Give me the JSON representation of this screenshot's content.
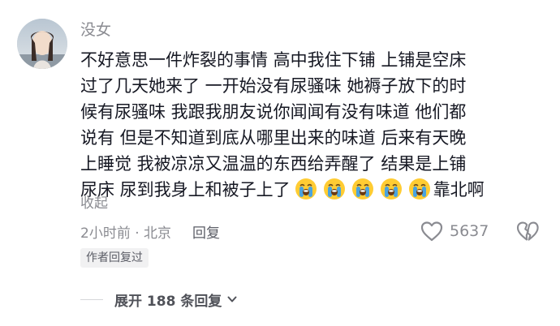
{
  "comment": {
    "username": "没女",
    "lines": [
      "不好意思一件炸裂的事情 高中我住下铺 上铺是空床",
      "过了几天她来了 一开始没有尿骚味 她褥子放下的时",
      "候有尿骚味 我跟我朋友说你闻闻有没有味道 他们都",
      "说有 但是不知道到底从哪里出来的味道 后来有天晚",
      "上睡觉 我被凉凉又温温的东西给弄醒了 结果是上铺"
    ],
    "last_line_before_emoji": "尿床 尿到我身上和被子上了",
    "emoji_icon": "loudly-crying-face-icon",
    "emoji_count": 5,
    "last_line_after_emoji": "靠北啊",
    "collapse_label": "收起",
    "time_location": "2小时前 · 北京",
    "reply_label": "回复",
    "like_count": "5637",
    "author_badge": "作者回复过",
    "expand_replies_label": "展开 188 条回复"
  },
  "colors": {
    "primary_text": "#161823",
    "secondary_text": "#8a8b91",
    "badge_bg": "#f1f1f2",
    "emoji_face": "#ffcc33",
    "emoji_tear": "#4aa3df"
  }
}
